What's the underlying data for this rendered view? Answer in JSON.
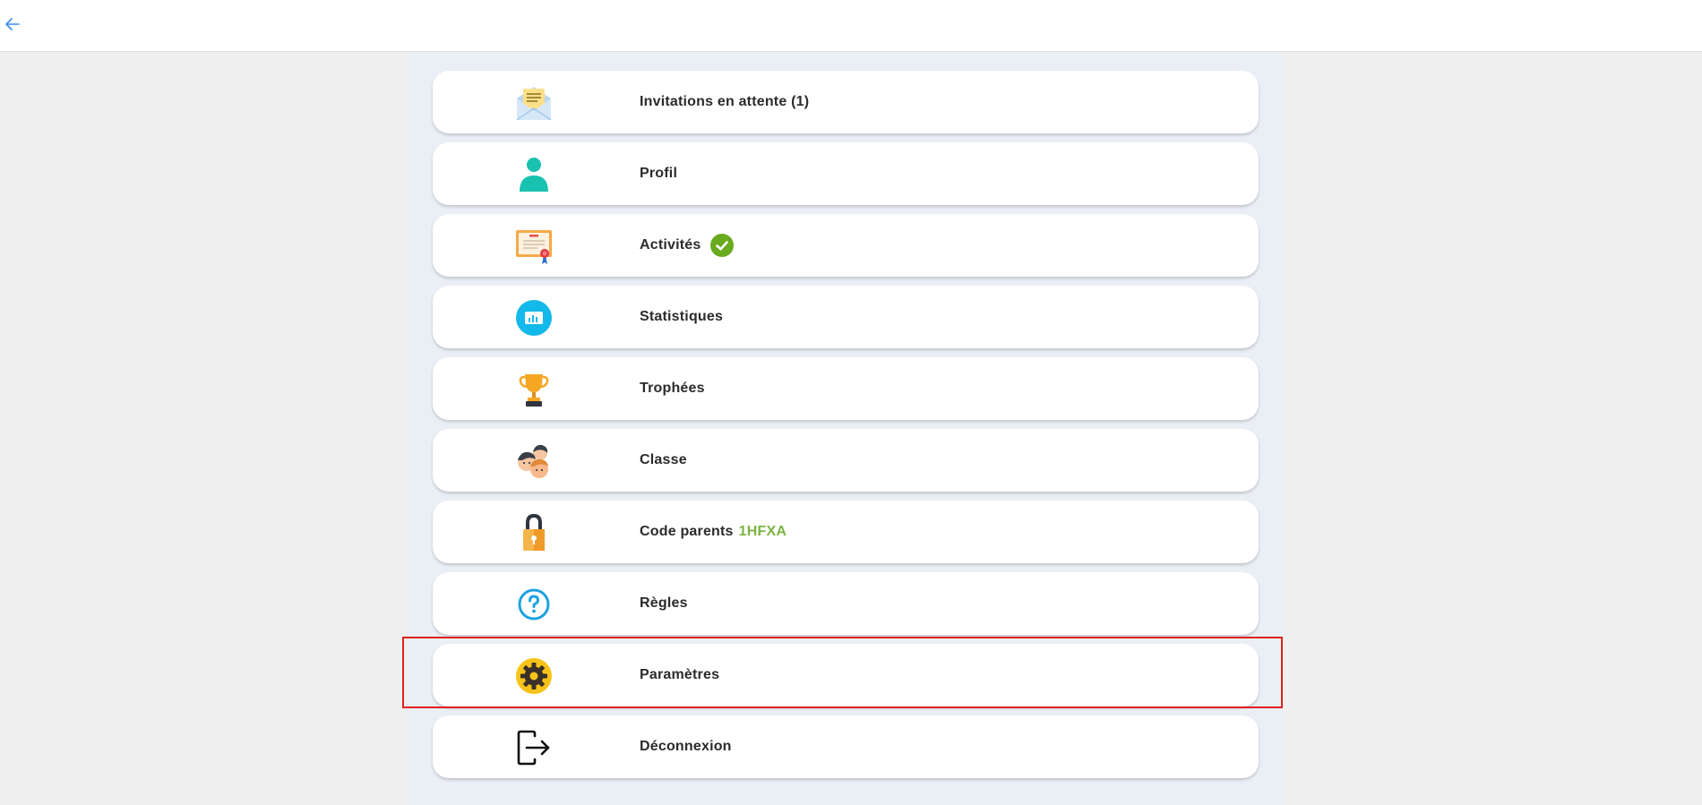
{
  "header": {
    "back_icon": "arrow-left-icon",
    "accent_color": "#3a8ef0"
  },
  "menu": {
    "items": [
      {
        "label": "Invitations en attente (1)",
        "icon": "envelope-letter-icon"
      },
      {
        "label": "Profil",
        "icon": "user-profile-icon"
      },
      {
        "label": "Activités",
        "icon": "certificate-icon",
        "badge_icon": "check-circle-icon",
        "badge_color": "#6aaa1e"
      },
      {
        "label": "Statistiques",
        "icon": "statistics-chart-icon"
      },
      {
        "label": "Trophées",
        "icon": "trophy-icon"
      },
      {
        "label": "Classe",
        "icon": "classmates-icon"
      },
      {
        "label": "Code parents",
        "code": "1HFXA",
        "icon": "padlock-icon",
        "code_color": "#7cb342"
      },
      {
        "label": "Règles",
        "icon": "help-question-icon"
      },
      {
        "label": "Paramètres",
        "icon": "settings-gear-icon",
        "highlighted": true
      },
      {
        "label": "Déconnexion",
        "icon": "logout-icon"
      }
    ]
  },
  "highlight_color": "#e02020"
}
